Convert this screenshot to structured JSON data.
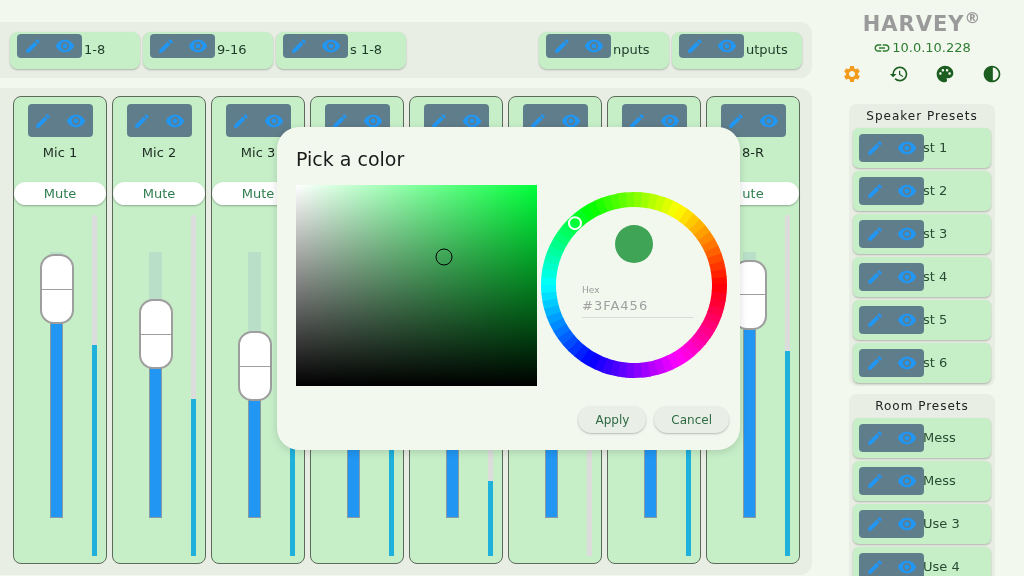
{
  "tabs_left": [
    {
      "label": "1-8"
    },
    {
      "label": "9-16"
    },
    {
      "label": "s 1-8"
    }
  ],
  "tabs_right": [
    {
      "label": "nputs"
    },
    {
      "label": "utputs"
    }
  ],
  "channels": [
    {
      "name": "Mic 1",
      "mute_button": "Mute",
      "fader": {
        "level": 0.86
      },
      "meter": {
        "level": 0.62
      }
    },
    {
      "name": "Mic 2",
      "mute_button": "Mute",
      "fader": {
        "level": 0.69
      },
      "meter": {
        "level": 0.46
      }
    },
    {
      "name": "Mic 3",
      "mute_button": "Mute",
      "fader": {
        "level": 0.57
      },
      "meter": {
        "level": 0.33
      }
    },
    {
      "fader": {
        "level": 0.5
      },
      "meter": {
        "level": 0.33
      }
    },
    {
      "fader": {
        "level": 0.5
      },
      "meter": {
        "level": 0.22
      }
    },
    {
      "fader": {
        "level": 0.5
      },
      "meter": {
        "level": 0
      }
    },
    {
      "fader": {
        "level": 0.5
      },
      "meter": {
        "level": 0.33
      }
    },
    {
      "name": "8-R",
      "mute_button": "ute",
      "fader": {
        "level": 0.84
      },
      "meter": {
        "level": 0.6
      }
    }
  ],
  "logo": "HARVEY$^{®}$",
  "address": "10.0.10.228",
  "toolbar": [
    {
      "kind": "settings",
      "selected": true
    },
    {
      "kind": "history",
      "selected": false
    },
    {
      "kind": "palette",
      "selected": false
    },
    {
      "kind": "contrast",
      "selected": false
    }
  ],
  "speaker_presets": {
    "title": "Speaker Presets",
    "items": [
      "st 1",
      "st 2",
      "st 3",
      "st 4",
      "st 5",
      "st 6"
    ]
  },
  "room_presets": {
    "title": "Room Presets",
    "items": [
      "Mess",
      "Mess",
      "Use 3",
      "Use 4"
    ]
  },
  "color_dialog": {
    "title": "Pick a color",
    "hex_label": "Hex",
    "hex_value": "#3FA456",
    "buttons": [
      "Apply",
      "Cancel"
    ]
  }
}
